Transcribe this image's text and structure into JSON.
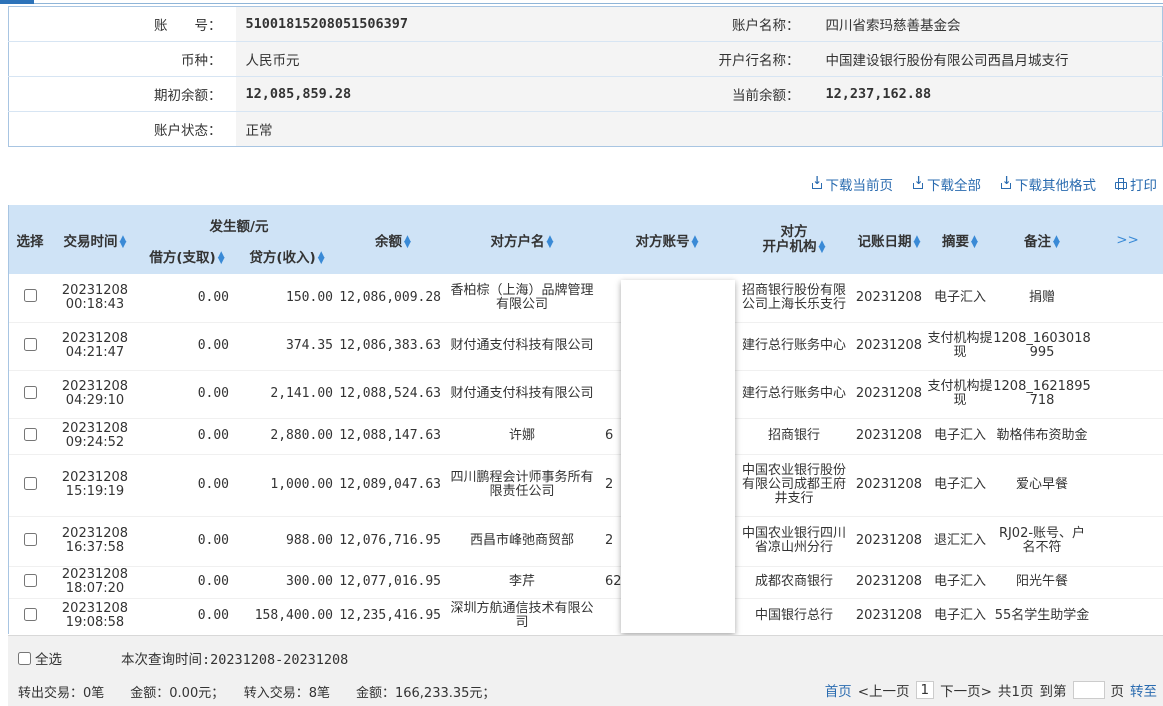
{
  "account": {
    "account_no_label": "账　　号：",
    "account_no": "51001815208051506397",
    "account_name_label": "账户名称：",
    "account_name": "四川省索玛慈善基金会",
    "currency_label": "币种：",
    "currency": "人民币元",
    "bank_label": "开户行名称：",
    "bank": "中国建设银行股份有限公司西昌月城支行",
    "opening_balance_label": "期初余额：",
    "opening_balance": "12,085,859.28",
    "current_balance_label": "当前余额：",
    "current_balance": "12,237,162.88",
    "status_label": "账户状态：",
    "status": "正常"
  },
  "toolbar": {
    "download_page": "下载当前页",
    "download_all": "下载全部",
    "download_other": "下载其他格式",
    "print": "打印"
  },
  "table": {
    "headers": {
      "select": "选择",
      "time": "交易时间",
      "amount_group": "发生额/元",
      "debit": "借方(支取)",
      "credit": "贷方(收入)",
      "balance": "余额",
      "counterparty": "对方户名",
      "counter_account": "对方账号",
      "counter_bank_l1": "对方",
      "counter_bank_l2": "开户机构",
      "post_date": "记账日期",
      "summary": "摘要",
      "remark": "备注",
      "more": ">>"
    },
    "rows": [
      {
        "date": "20231208",
        "time": "00:18:43",
        "debit": "0.00",
        "credit": "150.00",
        "balance": "12,086,009.28",
        "name": "香柏棕（上海）品牌管理有限公司",
        "account": "",
        "bank": "招商银行股份有限公司上海长乐支行",
        "post_date": "20231208",
        "summary": "电子汇入",
        "remark": "捐赠"
      },
      {
        "date": "20231208",
        "time": "04:21:47",
        "debit": "0.00",
        "credit": "374.35",
        "balance": "12,086,383.63",
        "name": "财付通支付科技有限公司",
        "account": "",
        "bank": "建行总行账务中心",
        "post_date": "20231208",
        "summary": "支付机构提现",
        "remark": "1208_1603018995"
      },
      {
        "date": "20231208",
        "time": "04:29:10",
        "debit": "0.00",
        "credit": "2,141.00",
        "balance": "12,088,524.63",
        "name": "财付通支付科技有限公司",
        "account": "",
        "bank": "建行总行账务中心",
        "post_date": "20231208",
        "summary": "支付机构提现",
        "remark": "1208_1621895718"
      },
      {
        "date": "20231208",
        "time": "09:24:52",
        "debit": "0.00",
        "credit": "2,880.00",
        "balance": "12,088,147.63",
        "name": "许娜",
        "account": "6",
        "bank": "招商银行",
        "post_date": "20231208",
        "summary": "电子汇入",
        "remark": "勒格伟布资助金"
      },
      {
        "date": "20231208",
        "time": "15:19:19",
        "debit": "0.00",
        "credit": "1,000.00",
        "balance": "12,089,047.63",
        "name": "四川鹏程会计师事务所有限责任公司",
        "account": "2",
        "bank": "中国农业银行股份有限公司成都王府井支行",
        "post_date": "20231208",
        "summary": "电子汇入",
        "remark": "爱心早餐"
      },
      {
        "date": "20231208",
        "time": "16:37:58",
        "debit": "0.00",
        "credit": "988.00",
        "balance": "12,076,716.95",
        "name": "西昌市峰弛商贸部",
        "account": "2",
        "bank": "中国农业银行四川省凉山州分行",
        "post_date": "20231208",
        "summary": "退汇汇入",
        "remark": "RJ02-账号、户名不符"
      },
      {
        "date": "20231208",
        "time": "18:07:20",
        "debit": "0.00",
        "credit": "300.00",
        "balance": "12,077,016.95",
        "name": "李芹",
        "account": "62",
        "bank": "成都农商银行",
        "post_date": "20231208",
        "summary": "电子汇入",
        "remark": "阳光午餐"
      },
      {
        "date": "20231208",
        "time": "19:08:58",
        "debit": "0.00",
        "credit": "158,400.00",
        "balance": "12,235,416.95",
        "name": "深圳方航通信技术有限公司",
        "account": "",
        "bank": "中国银行总行",
        "post_date": "20231208",
        "summary": "电子汇入",
        "remark": "55名学生助学金"
      }
    ]
  },
  "footer": {
    "select_all": "全选",
    "query_time": "本次查询时间:20231208-20231208",
    "summary": "转出交易：0笔　　金额：0.00元；　　转入交易：8笔　　金额：166,233.35元；",
    "first": "首页",
    "prev": "<上一页",
    "page": "1",
    "next": "下一页>",
    "total": "共1页",
    "goto": "到第",
    "page_unit": "页",
    "jump": "转至"
  },
  "colors": {
    "header_bg": "#cfe3f6",
    "link": "#2b6cb0",
    "border": "#a8c5e2"
  }
}
